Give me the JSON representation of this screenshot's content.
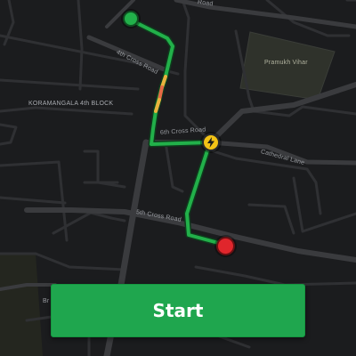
{
  "map": {
    "labels": {
      "street_top": "Road",
      "fourth_cross": "4th Cross Road",
      "district": "KORAMANGALA 4th BLOCK",
      "park": "Pramukh Vihar",
      "sixth_cross": "6th Cross Road",
      "cathedral": "Cathedral Lane",
      "fifth_cross": "5th Cross Road",
      "bottom_left": "Br"
    },
    "markers": {
      "origin": "origin-pin-icon",
      "charging": "lightning-icon",
      "destination": "destination-pin-icon"
    },
    "colors": {
      "route": "#22b04a",
      "traffic_slow": "#e9b23d",
      "traffic_heavy": "#e56a45",
      "origin_pin": "#22b04a",
      "destination_pin": "#e0262c",
      "charging_pin": "#f3c316"
    }
  },
  "actions": {
    "start_label": "Start"
  }
}
